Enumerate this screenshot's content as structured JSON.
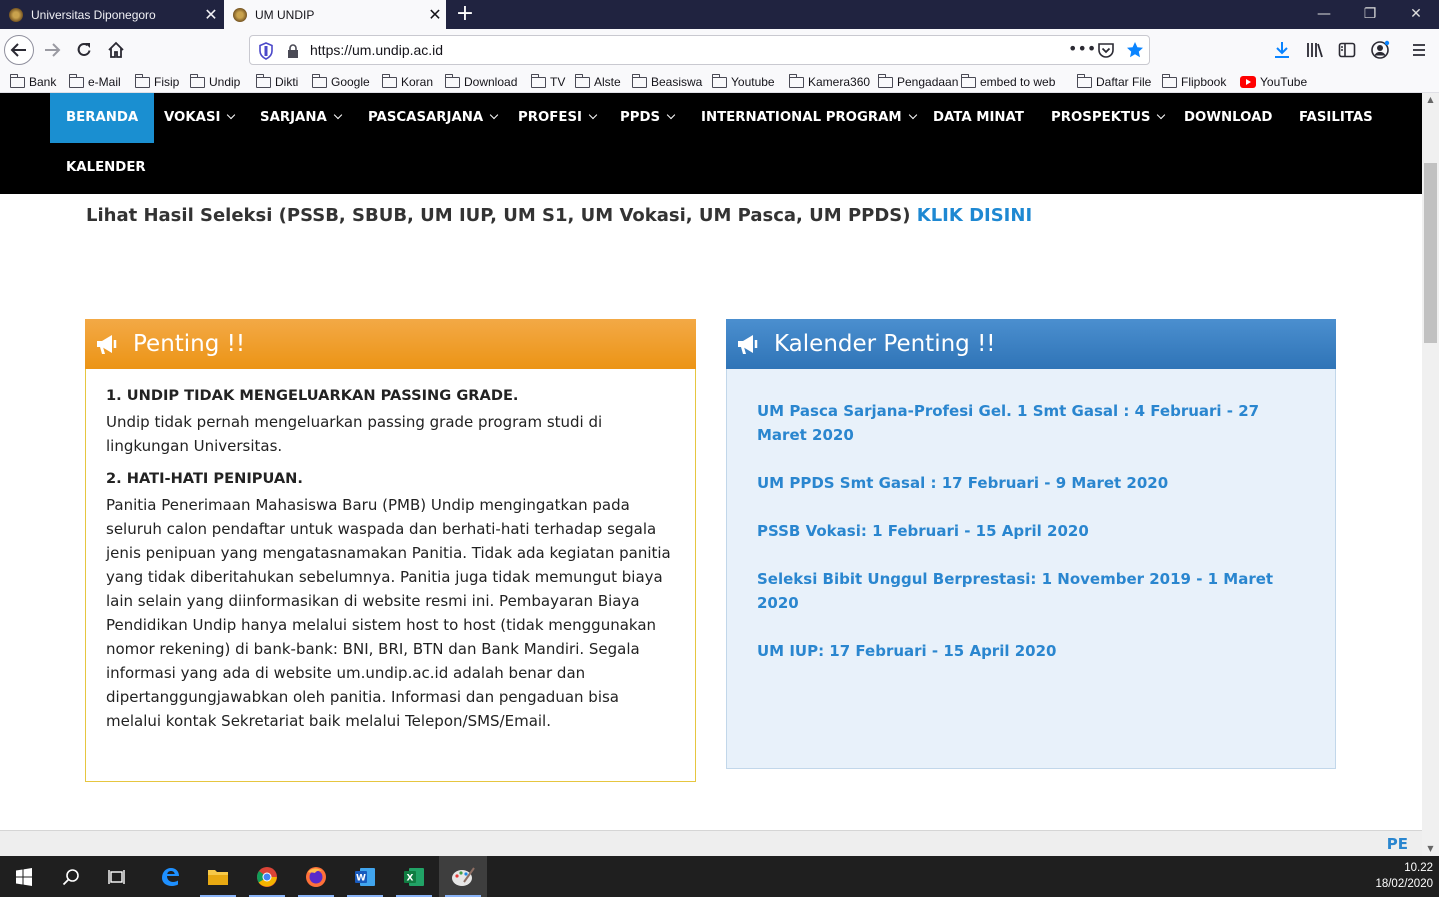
{
  "browser": {
    "tabs": [
      {
        "label": "Universitas Diponegoro",
        "active": false
      },
      {
        "label": "UM UNDIP",
        "active": true
      }
    ],
    "url": "https://um.undip.ac.id",
    "bookmarks": [
      {
        "label": "Bank",
        "icon": "folder-icon"
      },
      {
        "label": "e-Mail",
        "icon": "folder-icon"
      },
      {
        "label": "Fisip",
        "icon": "folder-icon"
      },
      {
        "label": "Undip",
        "icon": "folder-icon"
      },
      {
        "label": "Dikti",
        "icon": "folder-icon"
      },
      {
        "label": "Google",
        "icon": "folder-icon"
      },
      {
        "label": "Koran",
        "icon": "folder-icon"
      },
      {
        "label": "Download",
        "icon": "folder-icon"
      },
      {
        "label": "TV",
        "icon": "folder-icon"
      },
      {
        "label": "Alste",
        "icon": "folder-icon"
      },
      {
        "label": "Beasiswa",
        "icon": "folder-icon"
      },
      {
        "label": "Youtube",
        "icon": "folder-icon"
      },
      {
        "label": "Kamera360",
        "icon": "folder-icon"
      },
      {
        "label": "Pengadaan",
        "icon": "folder-icon"
      },
      {
        "label": "embed to web",
        "icon": "folder-icon"
      },
      {
        "label": "Daftar File",
        "icon": "folder-icon"
      },
      {
        "label": "Flipbook",
        "icon": "folder-icon"
      },
      {
        "label": "YouTube",
        "icon": "youtube-icon"
      }
    ]
  },
  "site": {
    "menu": [
      {
        "label": "BERANDA",
        "dropdown": false,
        "active": true
      },
      {
        "label": "VOKASI",
        "dropdown": true
      },
      {
        "label": "SARJANA",
        "dropdown": true
      },
      {
        "label": "PASCASARJANA",
        "dropdown": true
      },
      {
        "label": "PROFESI",
        "dropdown": true
      },
      {
        "label": "PPDS",
        "dropdown": true
      },
      {
        "label": "INTERNATIONAL PROGRAM",
        "dropdown": true
      },
      {
        "label": "DATA MINAT",
        "dropdown": false
      },
      {
        "label": "PROSPEKTUS",
        "dropdown": true
      },
      {
        "label": "DOWNLOAD",
        "dropdown": false
      },
      {
        "label": "FASILITAS",
        "dropdown": false
      },
      {
        "label": "KALENDER",
        "dropdown": false
      }
    ],
    "hasil_text": "Lihat Hasil Seleksi (PSSB, SBUB, UM IUP, UM S1, UM Vokasi, UM Pasca, UM PPDS)",
    "hasil_link": "KLIK DISINI",
    "penting": {
      "title": "Penting !!",
      "items": [
        {
          "heading": "1. UNDIP TIDAK MENGELUARKAN PASSING GRADE.",
          "text": "Undip tidak pernah mengeluarkan passing grade program studi di lingkungan Universitas."
        },
        {
          "heading": "2. HATI-HATI PENIPUAN.",
          "text": "Panitia Penerimaan Mahasiswa Baru (PMB) Undip mengingatkan pada seluruh calon pendaftar untuk waspada dan berhati-hati terhadap segala jenis penipuan yang mengatasnamakan Panitia. Tidak ada kegiatan panitia yang tidak diberitahukan sebelumnya. Panitia juga tidak memungut biaya lain selain yang diinformasikan di website resmi ini. Pembayaran Biaya Pendidikan Undip hanya melalui sistem host to host (tidak menggunakan nomor rekening) di bank-bank: BNI, BRI, BTN dan Bank Mandiri. Segala informasi yang ada di website um.undip.ac.id adalah benar dan dipertanggungjawabkan oleh panitia. Informasi dan pengaduan bisa melalui kontak Sekretariat baik melalui Telepon/SMS/Email."
        }
      ]
    },
    "kalender": {
      "title": "Kalender Penting !!",
      "items": [
        "UM Pasca Sarjana-Profesi Gel. 1 Smt Gasal : 4 Februari - 27 Maret 2020",
        "UM PPDS Smt Gasal : 17 Februari - 9 Maret 2020",
        "PSSB Vokasi: 1 Februari - 15 April 2020",
        "Seleksi Bibit Unggul Berprestasi: 1 November 2019 - 1 Maret 2020",
        "UM IUP: 17 Februari - 15 April 2020"
      ]
    },
    "footer_label": "PE"
  },
  "taskbar": {
    "apps": [
      "start-icon",
      "search-icon",
      "task-view-icon",
      "edge-icon",
      "file-explorer-icon",
      "chrome-icon",
      "firefox-icon",
      "word-icon",
      "excel-icon",
      "paint-icon"
    ],
    "time": "10.22",
    "date": "18/02/2020"
  },
  "colors": {
    "nav_bg": "#000000",
    "nav_active": "#1a8fd1",
    "link": "#2a86cf",
    "penting_header": "#ec9415",
    "kalender_header": "#2f74b7",
    "kalender_bg": "#e8f1fa"
  }
}
